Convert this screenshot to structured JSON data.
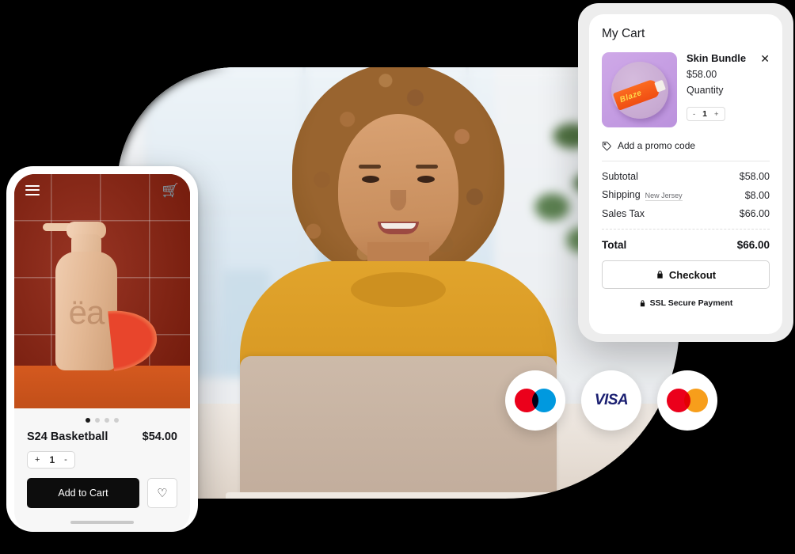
{
  "phone": {
    "topbar": {
      "menu_icon": "hamburger-menu-icon",
      "cart_icon": "shopping-cart-icon"
    },
    "product_image": {
      "brand_text": "ëa",
      "alt": "beige pump bottle with grapefruit slice on red tile"
    },
    "carousel": {
      "total_dots": 4,
      "active_index": 0
    },
    "product_name": "S24 Basketball",
    "product_price": "$54.00",
    "stepper": {
      "plus": "+",
      "value": "1",
      "minus": "-"
    },
    "add_to_cart_label": "Add to Cart",
    "wishlist_icon": "heart-icon"
  },
  "cart": {
    "title": "My Cart",
    "item": {
      "thumb_text": "Blaze",
      "name": "Skin Bundle",
      "price": "$58.00",
      "quantity_label": "Quantity",
      "remove_icon": "close-icon",
      "stepper": {
        "minus": "-",
        "value": "1",
        "plus": "+"
      }
    },
    "promo": {
      "icon": "tag-icon",
      "label": "Add a promo code"
    },
    "summary": [
      {
        "label": "Subtotal",
        "badge": "",
        "value": "$58.00"
      },
      {
        "label": "Shipping",
        "badge": "New Jersey",
        "value": "$8.00"
      },
      {
        "label": "Sales Tax",
        "badge": "",
        "value": "$66.00"
      }
    ],
    "total": {
      "label": "Total",
      "value": "$66.00"
    },
    "checkout": {
      "icon": "lock-icon",
      "label": "Checkout"
    },
    "ssl": {
      "icon": "lock-icon",
      "label": "SSL Secure Payment"
    }
  },
  "payments": [
    {
      "name": "maestro",
      "text": "",
      "color_a": "#eb001b",
      "color_b": "#0099df"
    },
    {
      "name": "visa",
      "text": "VISA",
      "color_a": "#1a1f71",
      "color_b": "#1a1f71"
    },
    {
      "name": "mastercard",
      "text": "",
      "color_a": "#eb001b",
      "color_b": "#f79e1b"
    }
  ],
  "hero": {
    "alt": "woman in yellow sweater smiling at a laptop in a bright office"
  }
}
